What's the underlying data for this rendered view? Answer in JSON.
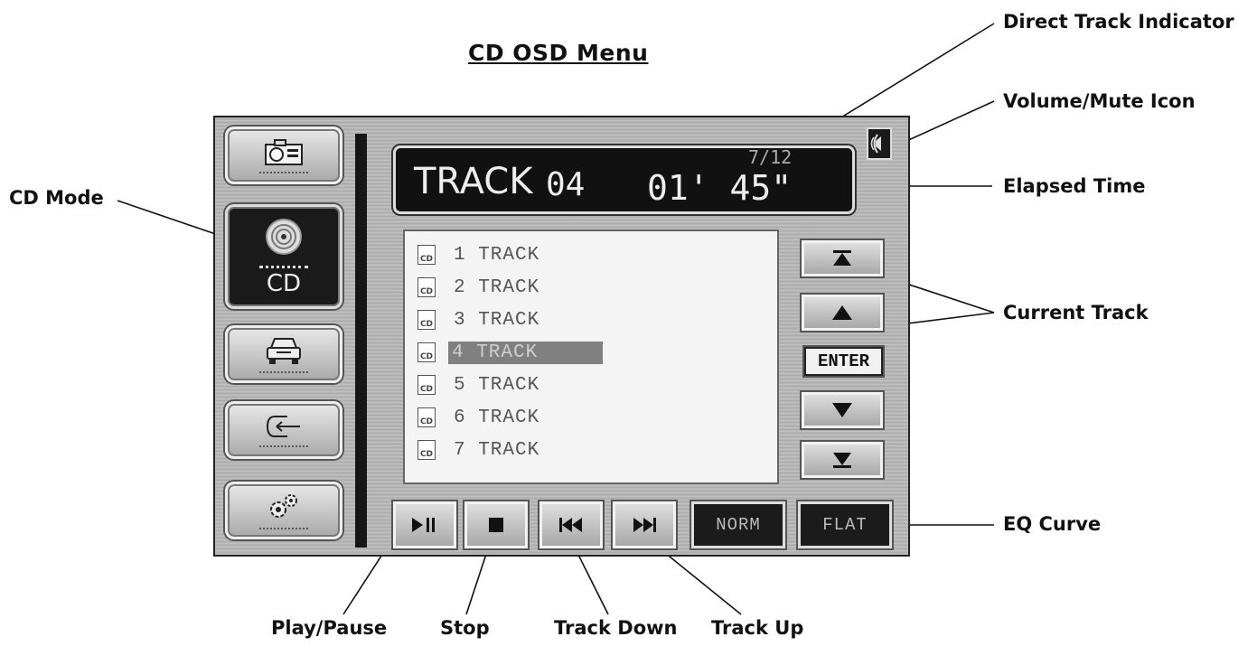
{
  "heading": "CD OSD Menu",
  "callouts": {
    "direct_track_indicator": "Direct Track Indicator",
    "volume_mute_icon": "Volume/Mute Icon",
    "cd_mode": "CD Mode",
    "elapsed_time": "Elapsed Time",
    "current_track": "Current Track",
    "eq_curve": "EQ Curve",
    "play_pause": "Play/Pause",
    "stop": "Stop",
    "track_down": "Track Down",
    "track_up": "Track Up"
  },
  "display": {
    "track_label": "TRACK",
    "track_number": "04",
    "elapsed_time": "01' 45\"",
    "direct_track": "7/12"
  },
  "sidebar": {
    "cd_label": "CD",
    "modes": [
      "camera-icon",
      "disc-icon",
      "car-icon",
      "input-icon",
      "settings-icon"
    ]
  },
  "tracks": [
    {
      "label": "1 TRACK",
      "icon_text": "CD"
    },
    {
      "label": "2 TRACK",
      "icon_text": "CD"
    },
    {
      "label": "3 TRACK",
      "icon_text": "CD"
    },
    {
      "label": "4 TRACK",
      "icon_text": "CD",
      "selected": true
    },
    {
      "label": "5 TRACK",
      "icon_text": "CD"
    },
    {
      "label": "6 TRACK",
      "icon_text": "CD"
    },
    {
      "label": "7 TRACK",
      "icon_text": "CD"
    }
  ],
  "nav": {
    "first_icon": "skip-to-top-icon",
    "up_icon": "up-triangle-icon",
    "enter_label": "ENTER",
    "down_icon": "down-triangle-icon",
    "last_icon": "skip-to-bottom-icon"
  },
  "controls": {
    "play_pause_icon": "play-pause-icon",
    "stop_icon": "stop-icon",
    "track_down_icon": "previous-track-icon",
    "track_up_icon": "next-track-icon",
    "norm_label": "NORM",
    "flat_label": "FLAT"
  }
}
